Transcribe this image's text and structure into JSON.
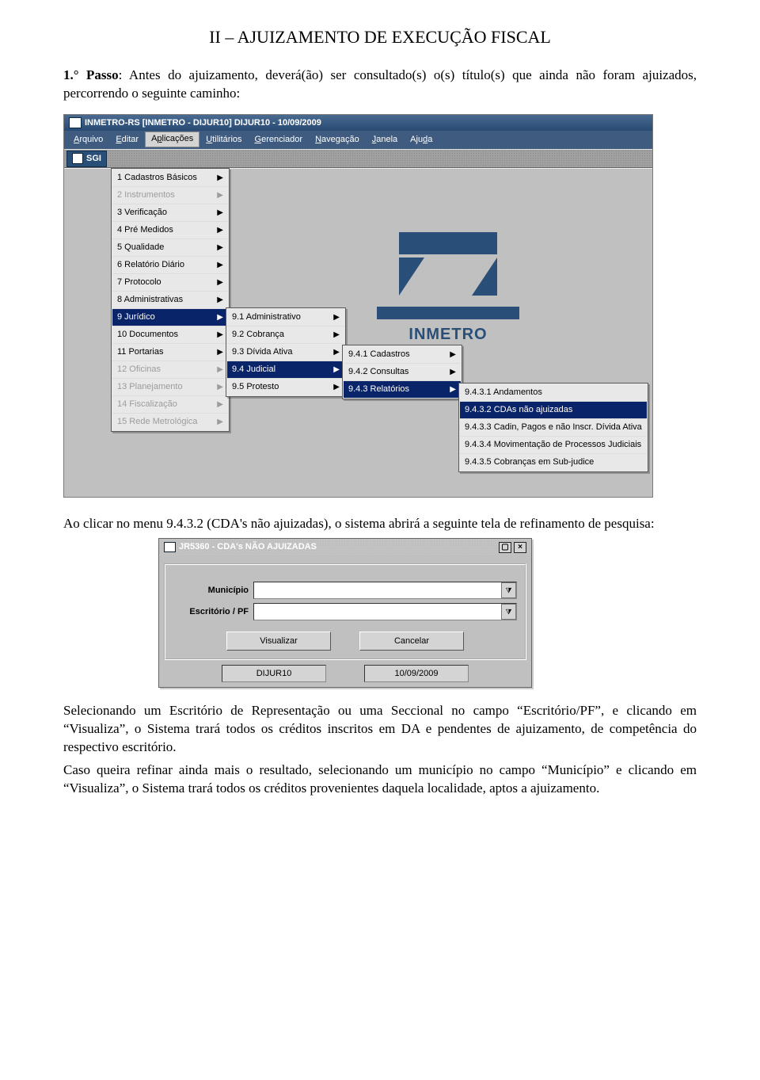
{
  "title": "II – AJUIZAMENTO DE EXECUÇÃO FISCAL",
  "passo_label": "1.° Passo",
  "passo_text": ": Antes do ajuizamento, deverá(ão) ser consultado(s) o(s) título(s) que ainda não foram ajuizados, percorrendo o seguinte caminho:",
  "app_titlebar": "INMETRO-RS  [INMETRO - DIJUR10]    DIJUR10 - 10/09/2009",
  "menubar": [
    "Arquivo",
    "Editar",
    "Aplicações",
    "Utilitários",
    "Gerenciador",
    "Navegação",
    "Janela",
    "Ajuda"
  ],
  "toolbar_sgi": "SGI",
  "menu1": [
    {
      "label": "1 Cadastros Básicos",
      "arrow": true
    },
    {
      "label": "2 Instrumentos",
      "arrow": true,
      "disabled": true
    },
    {
      "label": "3 Verificação",
      "arrow": true
    },
    {
      "label": "4 Pré Medidos",
      "arrow": true
    },
    {
      "label": "5 Qualidade",
      "arrow": true
    },
    {
      "label": "6 Relatório Diário",
      "arrow": true
    },
    {
      "label": "7 Protocolo",
      "arrow": true
    },
    {
      "label": "8 Administrativas",
      "arrow": true
    },
    {
      "label": "9 Jurídico",
      "arrow": true,
      "sel": true
    },
    {
      "label": "10 Documentos",
      "arrow": true
    },
    {
      "label": "11 Portarias",
      "arrow": true
    },
    {
      "label": "12 Oficinas",
      "arrow": true,
      "disabled": true
    },
    {
      "label": "13 Planejamento",
      "arrow": true,
      "disabled": true
    },
    {
      "label": "14 Fiscalização",
      "arrow": true,
      "disabled": true
    },
    {
      "label": "15 Rede Metrológica",
      "arrow": true,
      "disabled": true
    }
  ],
  "menu2": [
    {
      "label": "9.1 Administrativo",
      "arrow": true
    },
    {
      "label": "9.2 Cobrança",
      "arrow": true
    },
    {
      "label": "9.3 Dívida Ativa",
      "arrow": true
    },
    {
      "label": "9.4 Judicial",
      "arrow": true,
      "sel": true
    },
    {
      "label": "9.5 Protesto",
      "arrow": true
    }
  ],
  "menu3": [
    {
      "label": "9.4.1 Cadastros",
      "arrow": true
    },
    {
      "label": "9.4.2 Consultas",
      "arrow": true
    },
    {
      "label": "9.4.3 Relatórios",
      "arrow": true,
      "sel": true
    }
  ],
  "menu4": [
    {
      "label": "9.4.3.1 Andamentos"
    },
    {
      "label": "9.4.3.2 CDAs não ajuizadas",
      "sel": true
    },
    {
      "label": "9.4.3.3 Cadin, Pagos e não Inscr. Dívida Ativa"
    },
    {
      "label": "9.4.3.4 Movimentação de Processos Judiciais"
    },
    {
      "label": "9.4.3.5 Cobranças em Sub-judice"
    }
  ],
  "logo_text": "INMETRO",
  "mid_text": "Ao clicar no menu 9.4.3.2 (CDA's não ajuizadas), o sistema abrirá a seguinte tela de refinamento de pesquisa:",
  "dlg_title": "JR5360 -  CDA's NÃO AJUIZADAS",
  "fld_mun": "Município",
  "fld_esc": "Escritório / PF",
  "btn_visualizar": "Visualizar",
  "btn_cancelar": "Cancelar",
  "status_user": "DIJUR10",
  "status_date": "10/09/2009",
  "para_end": "Selecionando um Escritório de Representação ou uma Seccional no campo “Escritório/PF”, e clicando em “Visualiza”, o Sistema trará todos os créditos inscritos em DA e pendentes de ajuizamento, de competência do respectivo escritório.",
  "para_end2": "Caso queira refinar ainda mais o resultado, selecionando um município no campo “Município” e clicando em “Visualiza”, o Sistema trará todos os créditos provenientes daquela localidade, aptos a ajuizamento."
}
